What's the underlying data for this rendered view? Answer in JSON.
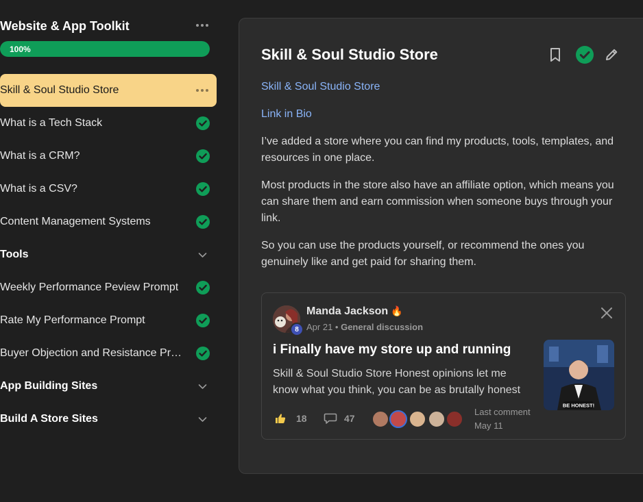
{
  "course": {
    "title": "Website & App Toolkit",
    "progress_label": "100%",
    "progress_fraction": 1.0
  },
  "lessons": [
    {
      "label": "Skill & Soul Studio Store",
      "state": "active"
    },
    {
      "label": "What is a Tech Stack",
      "state": "done"
    },
    {
      "label": "What is a CRM?",
      "state": "done"
    },
    {
      "label": "What is a CSV?",
      "state": "done"
    },
    {
      "label": "Content Management Systems",
      "state": "done"
    },
    {
      "label": "Tools",
      "state": "section"
    },
    {
      "label": "Weekly Performance Peview Prompt",
      "state": "done"
    },
    {
      "label": "Rate My Performance Prompt",
      "state": "done"
    },
    {
      "label": "Buyer Objection and Resistance Pro...",
      "state": "done"
    },
    {
      "label": "App Building Sites",
      "state": "section"
    },
    {
      "label": "Build A Store Sites",
      "state": "section"
    }
  ],
  "lesson_view": {
    "title": "Skill & Soul Studio Store",
    "link_store": "Skill & Soul Studio Store",
    "link_bio": "Link in Bio",
    "paragraphs": [
      "I’ve added a store where you can find my products, tools, templates, and resources in one place.",
      "Most products in the store also have an affiliate option, which means you can share them and earn commission when someone buys through your link.",
      "So you can use the products yourself, or recommend the ones you genuinely like and get paid for sharing them."
    ]
  },
  "post": {
    "author": "Manda Jackson",
    "level_badge": "8",
    "date": "Apr 21",
    "category": "General discussion",
    "title": "i Finally have my store up and running",
    "body": "Skill & Soul Studio Store Honest opinions let me know what you think, you can be as brutally honest",
    "likes": "18",
    "comments": "47",
    "last_comment_label": "Last comment",
    "last_comment_date": "May 11",
    "thumbnail_caption": "BE HONEST!"
  },
  "colors": {
    "accent_green": "#0f9d58",
    "active_item": "#f8d488",
    "link_blue": "#8ab4f8",
    "level_badge": "#3f51b5"
  }
}
